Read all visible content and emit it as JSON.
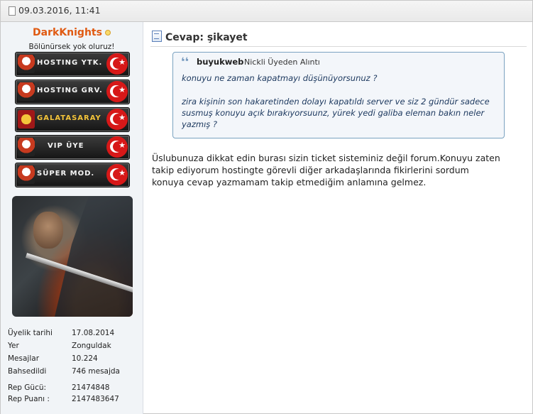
{
  "post": {
    "date": "09.03.2016, 11:41"
  },
  "user": {
    "name": "DarkKnights",
    "user_title": "Bölünürsek yok oluruz!",
    "ranks": [
      {
        "label": "HOSTING YTK.",
        "accent": "#f5f5f5"
      },
      {
        "label": "HOSTING GRV.",
        "accent": "#f5f5f5"
      },
      {
        "label": "GALATASARAY",
        "accent": "#f4c43a"
      },
      {
        "label": "VIP ÜYE",
        "accent": "#f5f5f5"
      },
      {
        "label": "SÜPER MOD.",
        "accent": "#f5f5f5"
      }
    ],
    "info": [
      {
        "label": "Üyelik tarihi",
        "value": "17.08.2014"
      },
      {
        "label": "Yer",
        "value": "Zonguldak"
      },
      {
        "label": "Mesajlar",
        "value": "10.224"
      },
      {
        "label": "Bahsedildi",
        "value": "746 mesajda"
      },
      {
        "label": "Rep Gücü:",
        "value": "21474848"
      },
      {
        "label": "Rep Puanı :",
        "value": "2147483647"
      }
    ]
  },
  "content": {
    "title": "Cevap: şikayet",
    "quote": {
      "author": "buyukweb",
      "suffix": "Nickli Üyeden Alıntı",
      "lines": [
        "konuyu ne zaman kapatmayı düşünüyorsunuz ?",
        "zira kişinin son hakaretinden dolayı kapatıldı server ve siz 2 gündür sadece",
        "susmuş konuyu açık bırakıyorsuunz, yürek yedi galiba eleman bakın neler",
        "yazmış ?"
      ]
    },
    "message_lines": [
      "Üslubunuza dikkat edin burası sizin ticket sisteminiz değil forum.Konuyu zaten",
      "takip ediyorum hostingte görevli diğer arkadaşlarında fikirlerini sordum",
      "konuya cevap yazmamam takip etmediğim anlamına gelmez."
    ]
  },
  "colors": {
    "username": "#e05a12",
    "quote_border": "#7aa2c0",
    "quote_text": "#1e3a60",
    "sidebar_bg": "#f1f4f7"
  },
  "icons": [
    "document-icon",
    "quote-icon",
    "online-status-icon",
    "turkish-flag-icon"
  ]
}
